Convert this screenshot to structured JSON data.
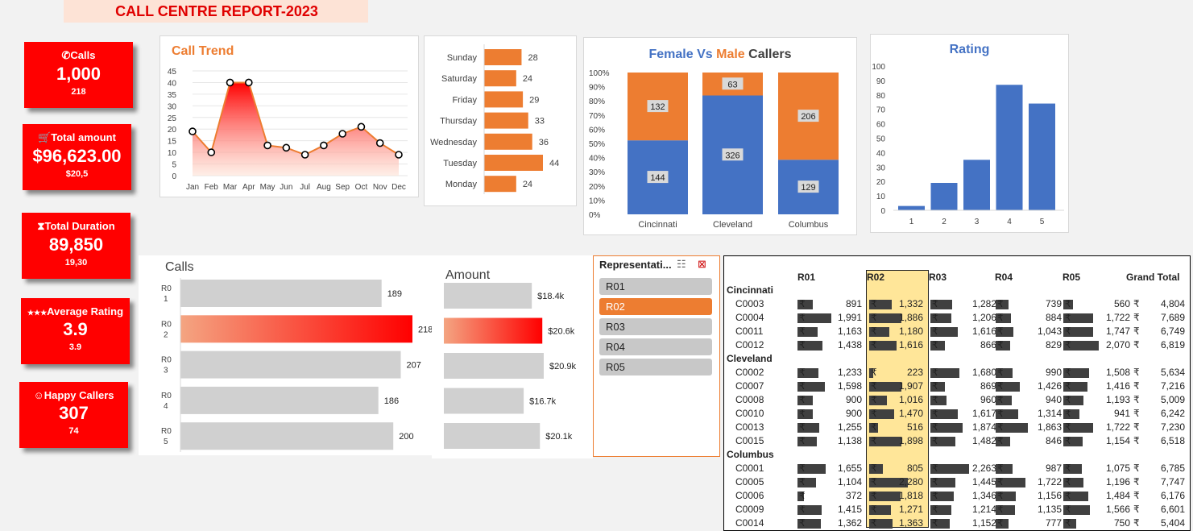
{
  "title": "CALL CENTRE REPORT-2023",
  "kpis": [
    {
      "label": "Calls",
      "value": "1,000",
      "sub": "218",
      "icon": "phone-icon"
    },
    {
      "label": "Total amount",
      "value": "$96,623.00",
      "sub": "$20,5",
      "icon": "cart-icon"
    },
    {
      "label": "Total Duration",
      "value": "89,850",
      "sub": "19,30",
      "icon": "hourglass-icon"
    },
    {
      "label": "Average Rating",
      "value": "3.9",
      "sub": "3.9",
      "icon": "stars-icon"
    },
    {
      "label": "Happy Callers",
      "value": "307",
      "sub": "74",
      "icon": "smiley-icon"
    }
  ],
  "colors": {
    "accent": "#ed7d31",
    "blue": "#4472c4",
    "red": "#ff0000",
    "grey": "#d0d0d0",
    "highlight": "#ffe699"
  },
  "trend": {
    "title": "Call Trend",
    "chart_data": {
      "type": "area",
      "categories": [
        "Jan",
        "Feb",
        "Mar",
        "Apr",
        "May",
        "Jun",
        "Jul",
        "Aug",
        "Sep",
        "Oct",
        "Nov",
        "Dec"
      ],
      "values": [
        19,
        10,
        40,
        40,
        13,
        12,
        9,
        13,
        18,
        21,
        14,
        9
      ],
      "ylim": [
        0,
        45
      ],
      "yticks": [
        0,
        5,
        10,
        15,
        20,
        25,
        30,
        35,
        40,
        45
      ]
    }
  },
  "weekday": {
    "chart_data": {
      "type": "bar",
      "categories": [
        "Sunday",
        "Saturday",
        "Friday",
        "Thursday",
        "Wednesday",
        "Tuesday",
        "Monday"
      ],
      "values": [
        28,
        24,
        29,
        33,
        36,
        44,
        24
      ]
    }
  },
  "gender": {
    "title_a": "Female",
    "title_vs": " Vs ",
    "title_b": "Male",
    "title_c": " Callers",
    "chart_data": {
      "type": "bar",
      "categories": [
        "Cincinnati",
        "Cleveland",
        "Columbus"
      ],
      "series": [
        {
          "name": "Female",
          "values": [
            144,
            326,
            129
          ]
        },
        {
          "name": "Male",
          "values": [
            132,
            63,
            206
          ]
        }
      ],
      "yticks": [
        "0%",
        "10%",
        "20%",
        "30%",
        "40%",
        "50%",
        "60%",
        "70%",
        "80%",
        "90%",
        "100%"
      ]
    }
  },
  "rating": {
    "title": "Rating",
    "chart_data": {
      "type": "bar",
      "categories": [
        "1",
        "2",
        "3",
        "4",
        "5"
      ],
      "values": [
        3,
        19,
        35,
        87,
        74
      ],
      "ylim": [
        0,
        100
      ],
      "yticks": [
        0,
        10,
        20,
        30,
        40,
        50,
        60,
        70,
        80,
        90,
        100
      ]
    }
  },
  "calls_by_rep": {
    "title": "Calls",
    "chart_data": {
      "type": "bar",
      "categories": [
        "R0\n1",
        "R0\n2",
        "R0\n3",
        "R0\n4",
        "R0\n5"
      ],
      "values": [
        189,
        218,
        207,
        186,
        200
      ],
      "labels": [
        "189",
        "218",
        "207",
        "186",
        "200"
      ]
    }
  },
  "amount_by_rep": {
    "title": "Amount",
    "chart_data": {
      "type": "bar",
      "values": [
        18.4,
        20.6,
        20.9,
        16.7,
        20.1
      ],
      "labels": [
        "$18.4k",
        "$20.6k",
        "$20.9k",
        "$16.7k",
        "$20.1k"
      ]
    }
  },
  "slicer": {
    "title": "Representati...",
    "items": [
      "R01",
      "R02",
      "R03",
      "R04",
      "R05"
    ],
    "selected": "R02"
  },
  "pivot": {
    "headers": [
      "",
      "R01",
      "R02",
      "R03",
      "R04",
      "R05",
      "Grand Total"
    ],
    "currency": "₹",
    "groups": [
      {
        "city": "Cincinnati",
        "rows": [
          {
            "id": "C0003",
            "vals": [
              "891",
              "1,332",
              "1,282",
              "739",
              "560",
              "4,804"
            ]
          },
          {
            "id": "C0004",
            "vals": [
              "1,991",
              "1,886",
              "1,206",
              "884",
              "1,722",
              "7,689"
            ]
          },
          {
            "id": "C0011",
            "vals": [
              "1,163",
              "1,180",
              "1,616",
              "1,043",
              "1,747",
              "6,749"
            ]
          },
          {
            "id": "C0012",
            "vals": [
              "1,438",
              "1,616",
              "866",
              "829",
              "2,070",
              "6,819"
            ]
          }
        ]
      },
      {
        "city": "Cleveland",
        "rows": [
          {
            "id": "C0002",
            "vals": [
              "1,233",
              "223",
              "1,680",
              "990",
              "1,508",
              "5,634"
            ]
          },
          {
            "id": "C0007",
            "vals": [
              "1,598",
              "1,907",
              "869",
              "1,426",
              "1,416",
              "7,216"
            ]
          },
          {
            "id": "C0008",
            "vals": [
              "900",
              "1,016",
              "960",
              "940",
              "1,193",
              "5,009"
            ]
          },
          {
            "id": "C0010",
            "vals": [
              "900",
              "1,470",
              "1,617",
              "1,314",
              "941",
              "6,242"
            ]
          },
          {
            "id": "C0013",
            "vals": [
              "1,255",
              "516",
              "1,874",
              "1,863",
              "1,722",
              "7,230"
            ]
          },
          {
            "id": "C0015",
            "vals": [
              "1,138",
              "1,898",
              "1,482",
              "846",
              "1,154",
              "6,518"
            ]
          }
        ]
      },
      {
        "city": "Columbus",
        "rows": [
          {
            "id": "C0001",
            "vals": [
              "1,655",
              "805",
              "2,263",
              "987",
              "1,075",
              "6,785"
            ]
          },
          {
            "id": "C0005",
            "vals": [
              "1,104",
              "2,280",
              "1,445",
              "1,722",
              "1,196",
              "7,747"
            ]
          },
          {
            "id": "C0006",
            "vals": [
              "372",
              "1,818",
              "1,346",
              "1,156",
              "1,484",
              "6,176"
            ]
          },
          {
            "id": "C0009",
            "vals": [
              "1,415",
              "1,271",
              "1,214",
              "1,135",
              "1,566",
              "6,601"
            ]
          },
          {
            "id": "C0014",
            "vals": [
              "1,362",
              "1,363",
              "1,152",
              "777",
              "750",
              "5,404"
            ]
          }
        ]
      }
    ]
  }
}
